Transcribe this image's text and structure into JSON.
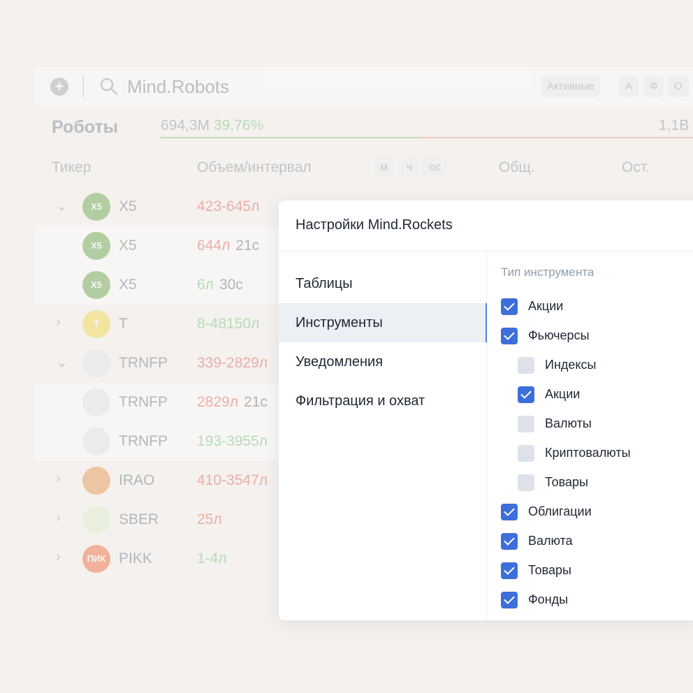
{
  "background": {
    "app_title": "Mind.Robots",
    "chips": [
      "Активные",
      "А",
      "Ф",
      "О"
    ],
    "robots_label": "Роботы",
    "total_volume": "694,3M",
    "total_pct": "39,76%",
    "right_total": "1,1B",
    "columns": {
      "ticker": "Тикер",
      "volume": "Объем/интервал",
      "total": "Общ.",
      "rest": "Ост."
    },
    "timeframes": [
      "м",
      "ч",
      "ос"
    ],
    "rows": [
      {
        "ticker": "X5",
        "volume": "423-645л",
        "interval": "",
        "sign": "neg",
        "child": false,
        "chevron": "⌄",
        "logo": "X5",
        "logo_color": "#5a9e3b"
      },
      {
        "ticker": "X5",
        "volume": "644л",
        "interval": "21с",
        "sign": "neg",
        "child": true,
        "chevron": "",
        "logo": "X5",
        "logo_color": "#5a9e3b"
      },
      {
        "ticker": "X5",
        "volume": "6л",
        "interval": "30с",
        "sign": "pos",
        "child": true,
        "chevron": "",
        "logo": "X5",
        "logo_color": "#5a9e3b"
      },
      {
        "ticker": "T",
        "volume": "8-48150л",
        "interval": "",
        "sign": "pos",
        "child": false,
        "chevron": "›",
        "logo": "T",
        "logo_color": "#f2d33a"
      },
      {
        "ticker": "TRNFP",
        "volume": "339-2829л",
        "interval": "",
        "sign": "neg",
        "child": false,
        "chevron": "⌄",
        "logo": "",
        "logo_color": "#dfe3ea"
      },
      {
        "ticker": "TRNFP",
        "volume": "2829л",
        "interval": "21с",
        "sign": "neg",
        "child": true,
        "chevron": "",
        "logo": "",
        "logo_color": "#dfe3ea"
      },
      {
        "ticker": "TRNFP",
        "volume": "193-3955л",
        "interval": "",
        "sign": "pos",
        "child": true,
        "chevron": "",
        "logo": "",
        "logo_color": "#dfe3ea"
      },
      {
        "ticker": "IRAO",
        "volume": "410-3547л",
        "interval": "",
        "sign": "neg",
        "child": false,
        "chevron": "›",
        "logo": "",
        "logo_color": "#e48b3c"
      },
      {
        "ticker": "SBER",
        "volume": "25л",
        "interval": "",
        "sign": "neg",
        "child": false,
        "chevron": "›",
        "logo": "",
        "logo_color": "#d9f0c8"
      },
      {
        "ticker": "PIKK",
        "volume": "1-4л",
        "interval": "",
        "sign": "pos",
        "child": false,
        "chevron": "›",
        "logo": "ПИК",
        "logo_color": "#f05a28"
      }
    ]
  },
  "modal": {
    "title": "Настройки Mind.Rockets",
    "nav": [
      {
        "label": "Таблицы",
        "active": false
      },
      {
        "label": "Инструменты",
        "active": true
      },
      {
        "label": "Уведомления",
        "active": false
      },
      {
        "label": "Фильтрация и охват",
        "active": false
      }
    ],
    "section_label": "Тип инструмента",
    "options": [
      {
        "label": "Акции",
        "checked": true,
        "level": 0
      },
      {
        "label": "Фьючерсы",
        "checked": true,
        "level": 0
      },
      {
        "label": "Индексы",
        "checked": false,
        "level": 1
      },
      {
        "label": "Акции",
        "checked": true,
        "level": 1
      },
      {
        "label": "Валюты",
        "checked": false,
        "level": 1
      },
      {
        "label": "Криптовалюты",
        "checked": false,
        "level": 1
      },
      {
        "label": "Товары",
        "checked": false,
        "level": 1
      },
      {
        "label": "Облигации",
        "checked": true,
        "level": 0
      },
      {
        "label": "Валюта",
        "checked": true,
        "level": 0
      },
      {
        "label": "Товары",
        "checked": true,
        "level": 0
      },
      {
        "label": "Фонды",
        "checked": true,
        "level": 0
      }
    ]
  }
}
